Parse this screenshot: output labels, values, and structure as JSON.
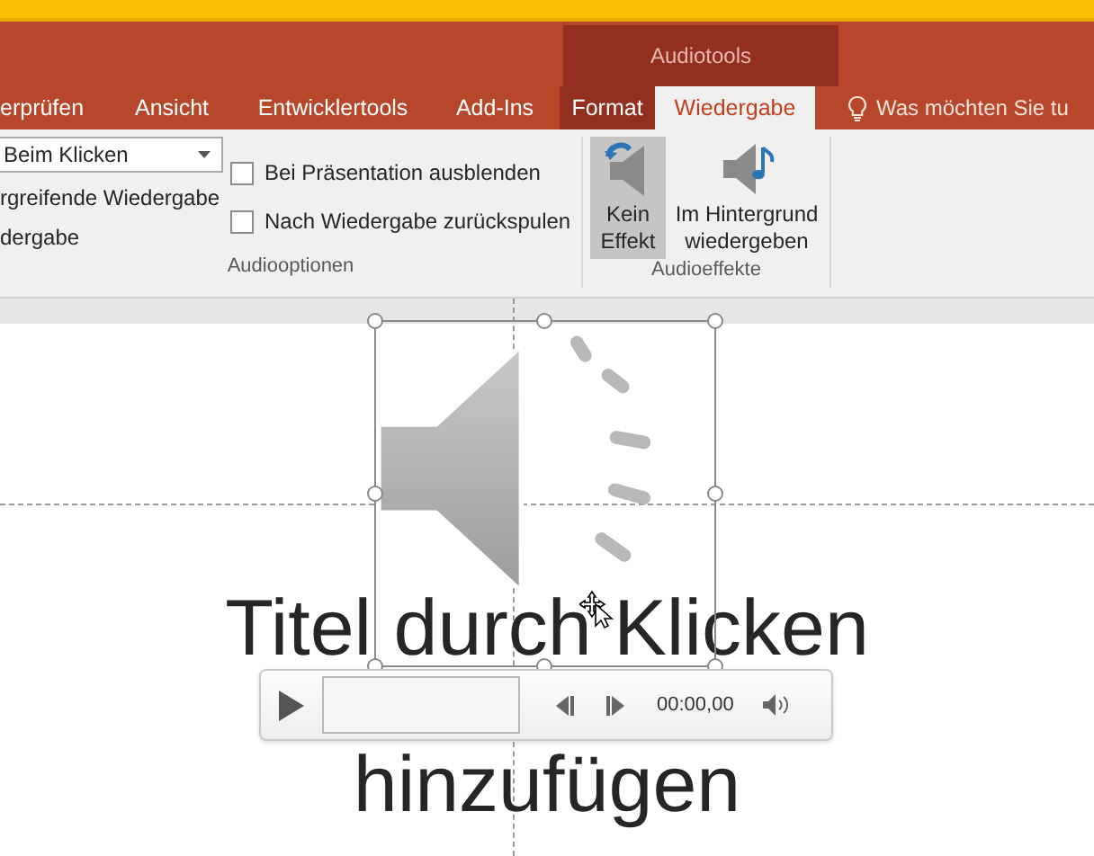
{
  "context_group": {
    "title": "Audiotools"
  },
  "tabs": [
    {
      "label": "erprüfen",
      "selected": false,
      "contextual": false
    },
    {
      "label": "Ansicht",
      "selected": false,
      "contextual": false
    },
    {
      "label": "Entwicklertools",
      "selected": false,
      "contextual": false
    },
    {
      "label": "Add-Ins",
      "selected": false,
      "contextual": false
    },
    {
      "label": "Format",
      "selected": false,
      "contextual": true
    },
    {
      "label": "Wiedergabe",
      "selected": true,
      "contextual": true
    }
  ],
  "tell_me": {
    "placeholder": "Was möchten Sie tu"
  },
  "ribbon": {
    "start_dropdown": {
      "value": "Beim Klicken"
    },
    "option_texts": [
      "rgreifende Wiedergabe",
      "dergabe"
    ],
    "checkboxes": [
      {
        "label": "Bei Präsentation ausblenden",
        "checked": false
      },
      {
        "label": "Nach Wiedergabe zurückspulen",
        "checked": false
      }
    ],
    "effects": [
      {
        "label": "Kein Effekt",
        "selected": true,
        "kind": "none"
      },
      {
        "label": "Im Hintergrund wiedergeben",
        "selected": false,
        "kind": "background"
      }
    ],
    "groups": [
      {
        "label": "Audiooptionen"
      },
      {
        "label": "Audioeffekte"
      }
    ]
  },
  "slide": {
    "title_placeholder_lines": [
      "Titel durch Klicken",
      "hinzufügen"
    ]
  },
  "player": {
    "time": "00:00,00"
  }
}
